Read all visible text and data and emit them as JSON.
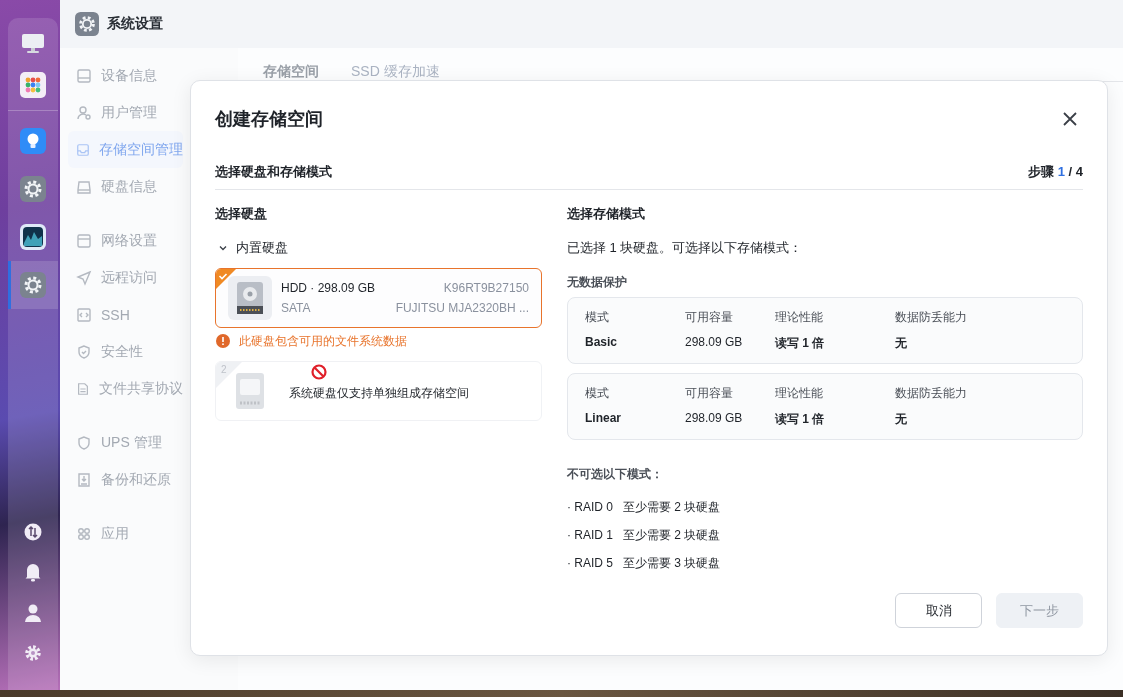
{
  "dock": {
    "top": [
      {
        "kind": "monitor",
        "selected": false
      },
      {
        "kind": "apps",
        "selected": false
      }
    ],
    "middle": [
      {
        "kind": "bulb",
        "selected": false
      },
      {
        "kind": "gear",
        "selected": false
      },
      {
        "kind": "chart",
        "selected": false
      },
      {
        "kind": "gear",
        "selected": true
      }
    ],
    "bottom": [
      {
        "kind": "transfer",
        "selected": false
      },
      {
        "kind": "bell",
        "selected": false
      },
      {
        "kind": "user",
        "selected": false
      },
      {
        "kind": "settings",
        "selected": false
      }
    ]
  },
  "window": {
    "title": "系统设置"
  },
  "sidebar": {
    "groups": [
      [
        {
          "label": "设备信息",
          "kind": "drive",
          "selected": false
        },
        {
          "label": "用户管理",
          "kind": "user",
          "selected": false
        },
        {
          "label": "存储空间管理",
          "kind": "tray",
          "selected": true
        },
        {
          "label": "硬盘信息",
          "kind": "disk",
          "selected": false
        }
      ],
      [
        {
          "label": "网络设置",
          "kind": "panel",
          "selected": false
        },
        {
          "label": "远程访问",
          "kind": "send",
          "selected": false
        },
        {
          "label": "SSH",
          "kind": "code",
          "selected": false
        },
        {
          "label": "安全性",
          "kind": "check",
          "selected": false
        },
        {
          "label": "文件共享协议",
          "kind": "file",
          "selected": false
        }
      ],
      [
        {
          "label": "UPS 管理",
          "kind": "shield",
          "selected": false
        },
        {
          "label": "备份和还原",
          "kind": "backup",
          "selected": false
        }
      ],
      [
        {
          "label": "应用",
          "kind": "grid",
          "selected": false
        }
      ]
    ]
  },
  "tabs": [
    {
      "label": "存储空间",
      "selected": true
    },
    {
      "label": "SSD 缓存加速",
      "selected": false
    }
  ],
  "dialog": {
    "title": "创建存储空间",
    "subtitle": "选择硬盘和存储模式",
    "step": {
      "label": "步骤",
      "current": "1",
      "total": "/ 4"
    },
    "disks_panel": {
      "heading": "选择硬盘",
      "group": {
        "label": "内置硬盘",
        "expanded": true
      },
      "disks": [
        {
          "kind": "hdd",
          "selected": true,
          "disabled": false,
          "title": "HDD · 298.09 GB",
          "bus": "SATA",
          "serial": "K96RT9B27150",
          "model": "FUJITSU MJA2320BH ..."
        },
        {
          "kind": "ssd",
          "selected": false,
          "disabled": true,
          "index": "2"
        }
      ],
      "warning": "此硬盘包含可用的文件系统数据",
      "tooltip": "系统硬盘仅支持单独组成存储空间"
    },
    "modes_panel": {
      "heading": "选择存储模式",
      "note": "已选择 1 块硬盘。可选择以下存储模式：",
      "section": "无数据保护",
      "modes": [
        {
          "selected": false,
          "fields": [
            {
              "label": "模式",
              "value": "Basic"
            },
            {
              "label": "可用容量",
              "value": "298.09 GB"
            },
            {
              "label": "理论性能",
              "value": "读写 1 倍"
            },
            {
              "label": "数据防丢能力",
              "value": "无"
            }
          ]
        },
        {
          "selected": false,
          "fields": [
            {
              "label": "模式",
              "value": "Linear"
            },
            {
              "label": "可用容量",
              "value": "298.09 GB"
            },
            {
              "label": "理论性能",
              "value": "读写 1 倍"
            },
            {
              "label": "数据防丢能力",
              "value": "无"
            }
          ]
        }
      ],
      "unavailable_title": "不可选以下模式：",
      "unavailable": [
        {
          "name": "· RAID 0",
          "requirement": "至少需要 2 块硬盘"
        },
        {
          "name": "· RAID 1",
          "requirement": "至少需要 2 块硬盘"
        },
        {
          "name": "· RAID 5",
          "requirement": "至少需要 3 块硬盘"
        }
      ]
    },
    "buttons": [
      {
        "label": "取消",
        "kind": "secondary",
        "disabled": false
      },
      {
        "label": "下一步",
        "kind": "primary",
        "disabled": true
      }
    ]
  }
}
